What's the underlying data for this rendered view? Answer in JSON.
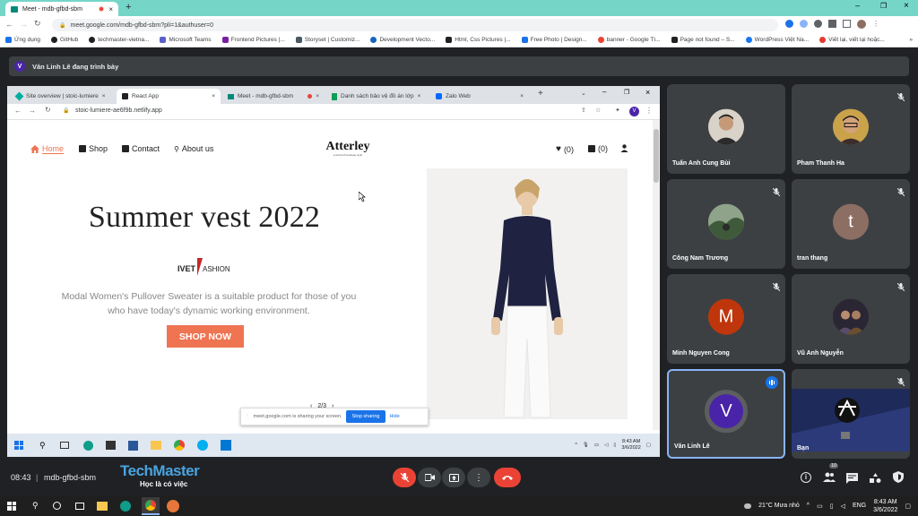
{
  "browser": {
    "tab_title": "Meet - mdb-gfbd-sbm",
    "url": "meet.google.com/mdb-gfbd-sbm?pli=1&authuser=0",
    "bookmarks": [
      "Ứng dụng",
      "GitHub",
      "techmaster-vietna...",
      "Microsoft Teams",
      "Frontend Pictures |...",
      "Storyset | Customiz...",
      "Development Vecto...",
      "Html, Css Pictures |...",
      "Free Photo | Design...",
      "banner - Google Tì...",
      "Page not found – S...",
      "WordPress Việt Na...",
      "Viết lại, viết lại hoặc..."
    ]
  },
  "presenter": {
    "initial": "V",
    "label": "Văn Linh Lê đang trình bày"
  },
  "shared": {
    "tabs": [
      "Site overview | stoic-lumiere",
      "React App",
      "Meet - mdb-gfbd-sbm",
      "Danh sách bảo vệ đồ án lớp",
      "Zalo Web"
    ],
    "url": "stoic-lumiere-ae6f9b.netlify.app",
    "nav": [
      "Home",
      "Shop",
      "Contact",
      "About us"
    ],
    "logo": "Atterley",
    "logo_sub": "a world of boutique style",
    "wishlist": "(0)",
    "cart": "(0)",
    "hero_title": "Summer vest 2022",
    "brand": "IVETFASHION",
    "hero_text": "Modal Women's Pullover Sweater is a suitable product for those of you who have today's dynamic working environment.",
    "cta": "SHOP NOW",
    "pager": "2/3",
    "sharing_text": "meet.google.com is sharing your screen.",
    "stop_label": "Stop sharing",
    "hide_label": "Hide",
    "win_time": "8:43 AM",
    "win_date": "3/6/2022"
  },
  "participants": [
    {
      "name": "Tuấn Anh Cung Bùi",
      "initial": "",
      "color": "#6b5a48",
      "muted": false,
      "photo": true
    },
    {
      "name": "Pham Thanh Ha",
      "initial": "",
      "color": "#8a7b63",
      "muted": true,
      "photo": true
    },
    {
      "name": "Công Nam Trương",
      "initial": "",
      "color": "#5f6e5a",
      "muted": true,
      "photo": true
    },
    {
      "name": "tran thang",
      "initial": "t",
      "color": "#8d6e63",
      "muted": true,
      "photo": false
    },
    {
      "name": "Minh Nguyen Cong",
      "initial": "M",
      "color": "#bf360c",
      "muted": true,
      "photo": false
    },
    {
      "name": "Vũ Anh Nguyễn",
      "initial": "",
      "color": "#3e3a4a",
      "muted": true,
      "photo": true
    },
    {
      "name": "Văn Linh Lê",
      "initial": "V",
      "color": "#4a24a8",
      "muted": false,
      "photo": false,
      "speaking": true
    },
    {
      "name": "Bạn",
      "initial": "",
      "color": "#1e2a5a",
      "muted": true,
      "photo": true
    }
  ],
  "meeting": {
    "time": "08:43",
    "code": "mdb-gfbd-sbm",
    "watermark": "TechMaster",
    "watermark_sub": "Học là có việc",
    "people_count": "10"
  },
  "os": {
    "weather": "21°C  Mưa nhỏ",
    "time": "8:43 AM",
    "date": "3/6/2022",
    "lang": "ENG"
  },
  "colors": {
    "accent_orange": "#ee7452",
    "meet_bg": "#202124",
    "end_call": "#ea4335",
    "tab_strip": "#75d6c8"
  }
}
